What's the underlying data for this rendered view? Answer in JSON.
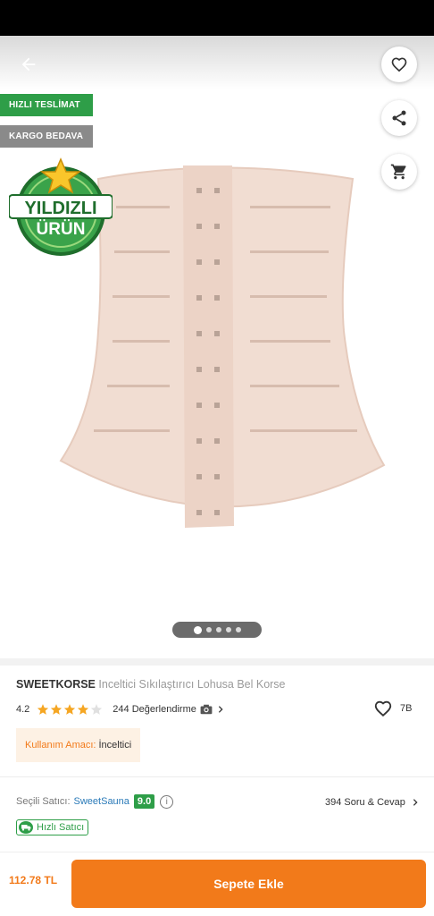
{
  "header": {
    "back_icon": "arrow-left-icon",
    "favorite_icon": "heart-outline-icon",
    "share_icon": "share-icon",
    "cart_icon": "shopping-cart-icon"
  },
  "badges": {
    "fast_delivery": "HIZLI TESLİMAT",
    "free_shipping": "KARGO BEDAVA",
    "starred_product_line1": "YILDIZLI",
    "starred_product_line2": "ÜRÜN"
  },
  "gallery": {
    "slide_count": 5,
    "active_index": 0
  },
  "product": {
    "brand": "SWEETKORSE",
    "name": "Inceltici Sıkılaştırıcı Lohusa Bel Korse",
    "rating": "4.2",
    "rating_value": 4.2,
    "reviews": "244 Değerlendirme",
    "favorites": "7B",
    "purpose_label": "Kullanım Amacı:",
    "purpose_value": "İnceltici"
  },
  "seller": {
    "label": "Seçili Satıcı:",
    "name": "SweetSauna",
    "score": "9.0",
    "info": "i",
    "qa": "394 Soru & Cevap",
    "fast_seller": "Hızlı Satıcı"
  },
  "footer": {
    "price": "112.78 TL",
    "add_to_cart": "Sepete Ekle"
  },
  "colors": {
    "accent": "#f27a1a",
    "green": "#2e9e48",
    "star": "#f5a623",
    "link": "#2a7ab8"
  }
}
